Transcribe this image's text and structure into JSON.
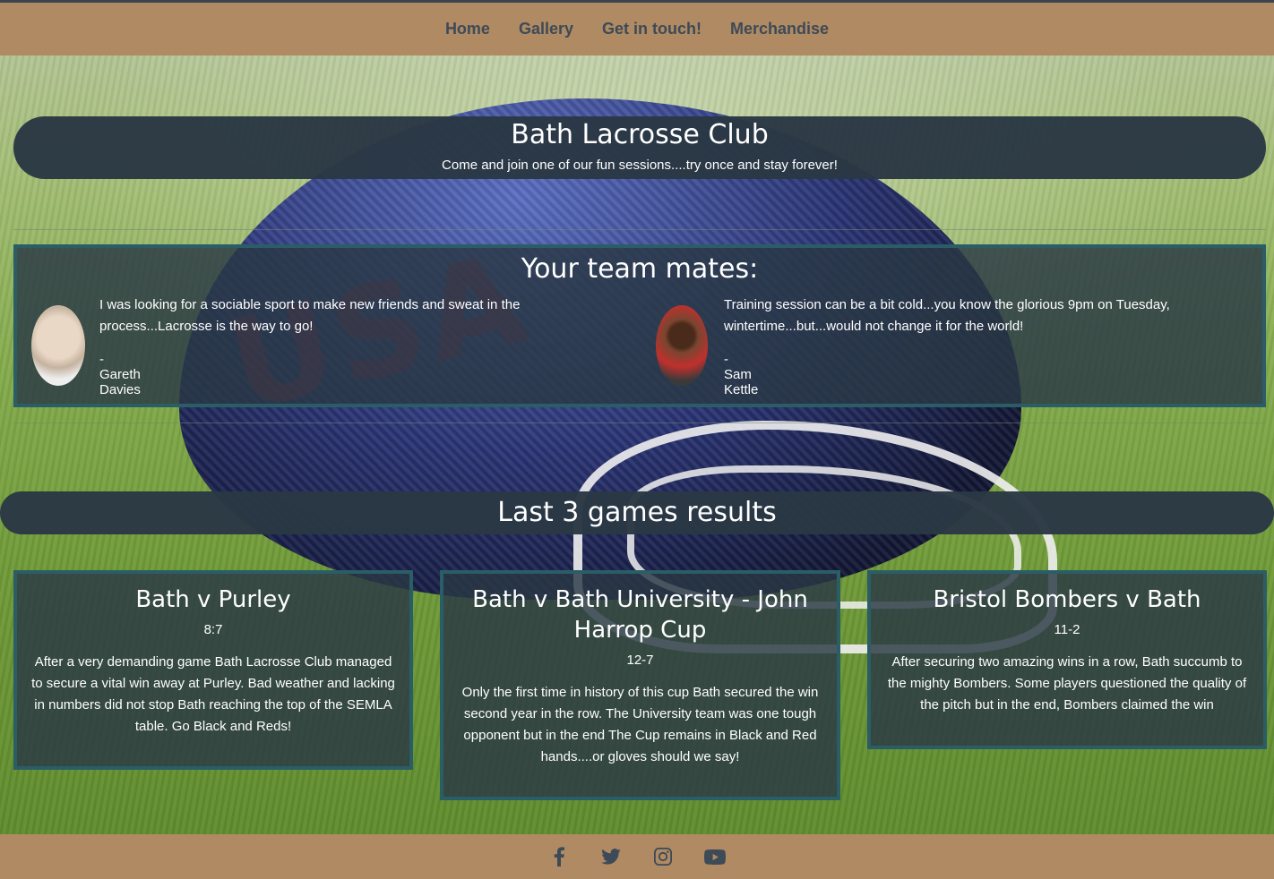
{
  "nav": {
    "items": [
      {
        "label": "Home"
      },
      {
        "label": "Gallery"
      },
      {
        "label": "Get in touch!"
      },
      {
        "label": "Merchandise"
      }
    ]
  },
  "hero": {
    "title": "Bath Lacrosse Club",
    "subtitle": "Come and join one of our fun sessions....try once and stay forever!"
  },
  "background": {
    "helmet_text": "USA"
  },
  "mates": {
    "heading": "Your team mates:",
    "testimonials": [
      {
        "quote": "I was looking for a sociable sport to make new friends and sweat in the process...Lacrosse is the way to go!",
        "author": "- Gareth Davies"
      },
      {
        "quote": "Training session can be a bit cold...you know the glorious 9pm on Tuesday, wintertime...but...would not change it for the world!",
        "author": "- Sam Kettle"
      }
    ]
  },
  "results": {
    "heading": "Last 3 games results",
    "games": [
      {
        "title": "Bath v Purley",
        "score": "8:7",
        "description": "After a very demanding game Bath Lacrosse Club managed to secure a vital win away at Purley. Bad weather and lacking in numbers did not stop Bath reaching the top of the SEMLA table. Go Black and Reds!"
      },
      {
        "title": "Bath v Bath University - John Harrop Cup",
        "score": "12-7",
        "description": "Only the first time in history of this cup Bath secured the win second year in the row. The University team was one tough opponent but in the end The Cup remains in Black and Red hands....or gloves should we say!"
      },
      {
        "title": "Bristol Bombers v Bath",
        "score": "11-2",
        "description": "After securing two amazing wins in a row, Bath succumb to the mighty Bombers. Some players questioned the quality of the pitch but in the end, Bombers claimed the win"
      }
    ]
  },
  "footer": {
    "icons": [
      "facebook-icon",
      "twitter-icon",
      "instagram-icon",
      "youtube-icon"
    ]
  },
  "colors": {
    "navbar": "#b08a63",
    "panel": "#2a3844",
    "panel_border": "#2b5d67",
    "nav_text": "#3d4a57"
  }
}
